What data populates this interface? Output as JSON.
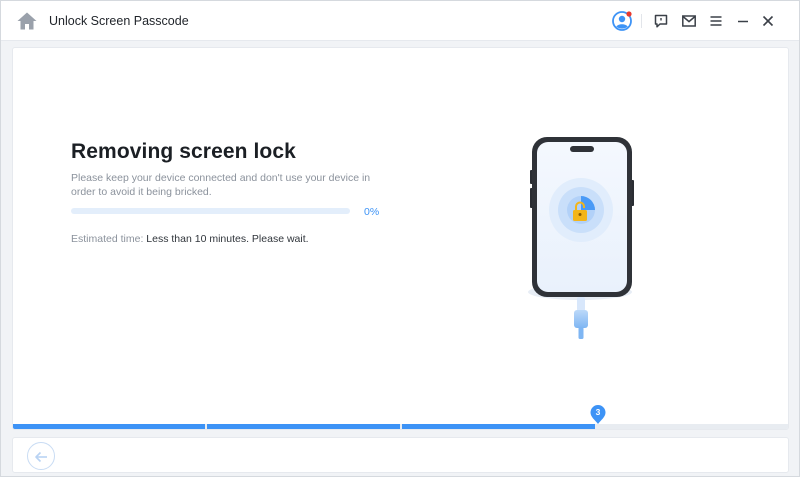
{
  "window": {
    "title": "Unlock Screen Passcode"
  },
  "icons": {
    "home": "home-icon",
    "account": "user-account-icon",
    "feedback": "feedback-icon",
    "mail": "mail-icon",
    "menu": "menu-icon",
    "minimize": "minimize-icon",
    "close": "close-icon",
    "back": "back-arrow-icon"
  },
  "main": {
    "heading": "Removing screen lock",
    "description": "Please keep your device connected and don't use your device in order to avoid it being bricked.",
    "progress": {
      "value": 0,
      "label": "0%"
    },
    "eta": {
      "label": "Estimated time: ",
      "value": "Less than 10 minutes. Please wait."
    }
  },
  "steps": {
    "total": 4,
    "current": 3,
    "current_label": "3"
  },
  "colors": {
    "accent": "#3d93f6",
    "track": "#e3eefb",
    "notification_dot": "#e8392f",
    "lock": "#f3b51a"
  }
}
